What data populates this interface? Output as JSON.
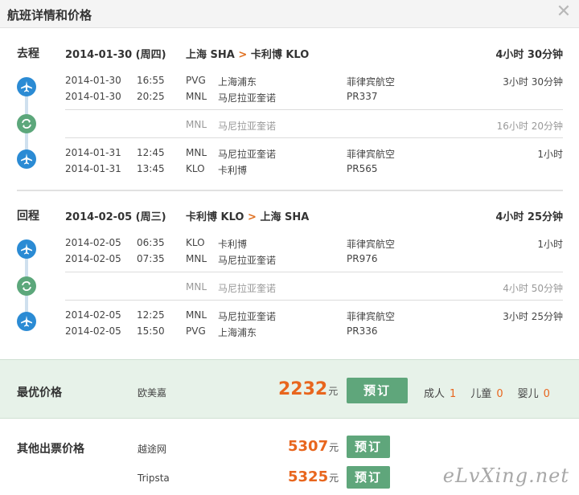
{
  "window": {
    "title": "航班详情和价格",
    "close_glyph": "✕"
  },
  "outbound": {
    "label": "去程",
    "date": "2014-01-30 (周四)",
    "route_from": "上海 SHA",
    "route_sep": ">",
    "route_to": "卡利博 KLO",
    "total": "4小时 30分钟",
    "seg1": {
      "dep_date": "2014-01-30",
      "dep_time": "16:55",
      "dep_code": "PVG",
      "dep_name": "上海浦东",
      "arr_date": "2014-01-30",
      "arr_time": "20:25",
      "arr_code": "MNL",
      "arr_name": "马尼拉亚奎诺",
      "airline": "菲律宾航空",
      "flight": "PR337",
      "duration": "3小时 30分钟"
    },
    "transfer": {
      "code": "MNL",
      "name": "马尼拉亚奎诺",
      "duration": "16小时 20分钟"
    },
    "seg2": {
      "dep_date": "2014-01-31",
      "dep_time": "12:45",
      "dep_code": "MNL",
      "dep_name": "马尼拉亚奎诺",
      "arr_date": "2014-01-31",
      "arr_time": "13:45",
      "arr_code": "KLO",
      "arr_name": "卡利博",
      "airline": "菲律宾航空",
      "flight": "PR565",
      "duration": "1小时"
    }
  },
  "return": {
    "label": "回程",
    "date": "2014-02-05 (周三)",
    "route_from": "卡利博 KLO",
    "route_sep": ">",
    "route_to": "上海 SHA",
    "total": "4小时 25分钟",
    "seg1": {
      "dep_date": "2014-02-05",
      "dep_time": "06:35",
      "dep_code": "KLO",
      "dep_name": "卡利博",
      "arr_date": "2014-02-05",
      "arr_time": "07:35",
      "arr_code": "MNL",
      "arr_name": "马尼拉亚奎诺",
      "airline": "菲律宾航空",
      "flight": "PR976",
      "duration": "1小时"
    },
    "transfer": {
      "code": "MNL",
      "name": "马尼拉亚奎诺",
      "duration": "4小时 50分钟"
    },
    "seg2": {
      "dep_date": "2014-02-05",
      "dep_time": "12:25",
      "dep_code": "MNL",
      "dep_name": "马尼拉亚奎诺",
      "arr_date": "2014-02-05",
      "arr_time": "15:50",
      "arr_code": "PVG",
      "arr_name": "上海浦东",
      "airline": "菲律宾航空",
      "flight": "PR336",
      "duration": "3小时 25分钟"
    }
  },
  "best_price": {
    "label": "最优价格",
    "vendor": "欧美嘉",
    "price": "2232",
    "currency": "元",
    "button": "预订",
    "adult_label": "成人",
    "adult_count": "1",
    "child_label": "儿童",
    "child_count": "0",
    "infant_label": "婴儿",
    "infant_count": "0"
  },
  "other_prices": {
    "label": "其他出票价格",
    "items": [
      {
        "vendor": "越途网",
        "price": "5307",
        "currency": "元",
        "button": "预订"
      },
      {
        "vendor": "Tripsta",
        "price": "5325",
        "currency": "元",
        "button": "预订"
      }
    ]
  },
  "watermark": "eLvXing.net",
  "colors": {
    "accent_orange": "#e8661e",
    "plane_blue": "#2b8bd4",
    "transfer_green": "#5ca77b",
    "button_green": "#5fa67b",
    "best_bg": "#e7f2e9"
  }
}
